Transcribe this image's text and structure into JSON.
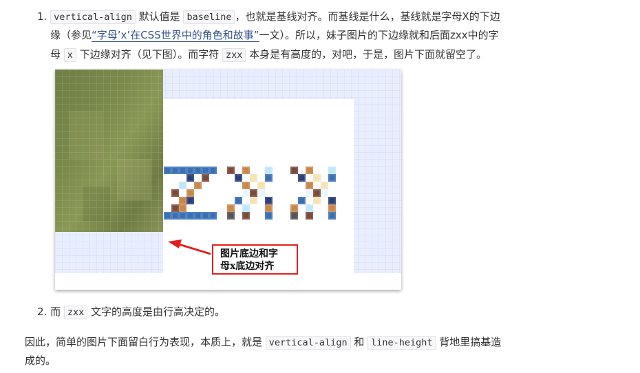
{
  "item1": {
    "number": "1.",
    "code_va": "vertical-align",
    "t1": " 默认值是 ",
    "code_baseline": "baseline",
    "t2": "，也就是基线对齐。而基线是什么，基线就是字母X的下边",
    "t3": "缘（参见",
    "link_text": "“字母’x’在CSS世界中的角色和故事”",
    "t4": "一文）。所以，妹子图片的下边缘就和后面zxx中的字",
    "t5": "母 ",
    "code_x": "x",
    "t6": " 下边缘对齐（见下图）。而字符 ",
    "code_zxx": "zxx",
    "t7": " 本身是有高度的，对吧，于是，图片下面就留空了。"
  },
  "figure": {
    "callout_line1": "图片底边和字",
    "callout_line2": "母x底边对齐",
    "colors": {
      "arrow": "#e41e1e",
      "grid_bg": "#e6ecff",
      "grid_line": "#cfd8f5"
    }
  },
  "item2": {
    "number": "2.",
    "t1": "而 ",
    "code_zxx": "zxx",
    "t2": " 文字的高度是由行高决定的。"
  },
  "conclusion": {
    "t1": "因此，简单的图片下面留白行为表现，本质上，就是 ",
    "code_va": "vertical-align",
    "t2": " 和 ",
    "code_lh": "line-height",
    "t3": " 背地里搞基造",
    "t4": "成的。"
  }
}
